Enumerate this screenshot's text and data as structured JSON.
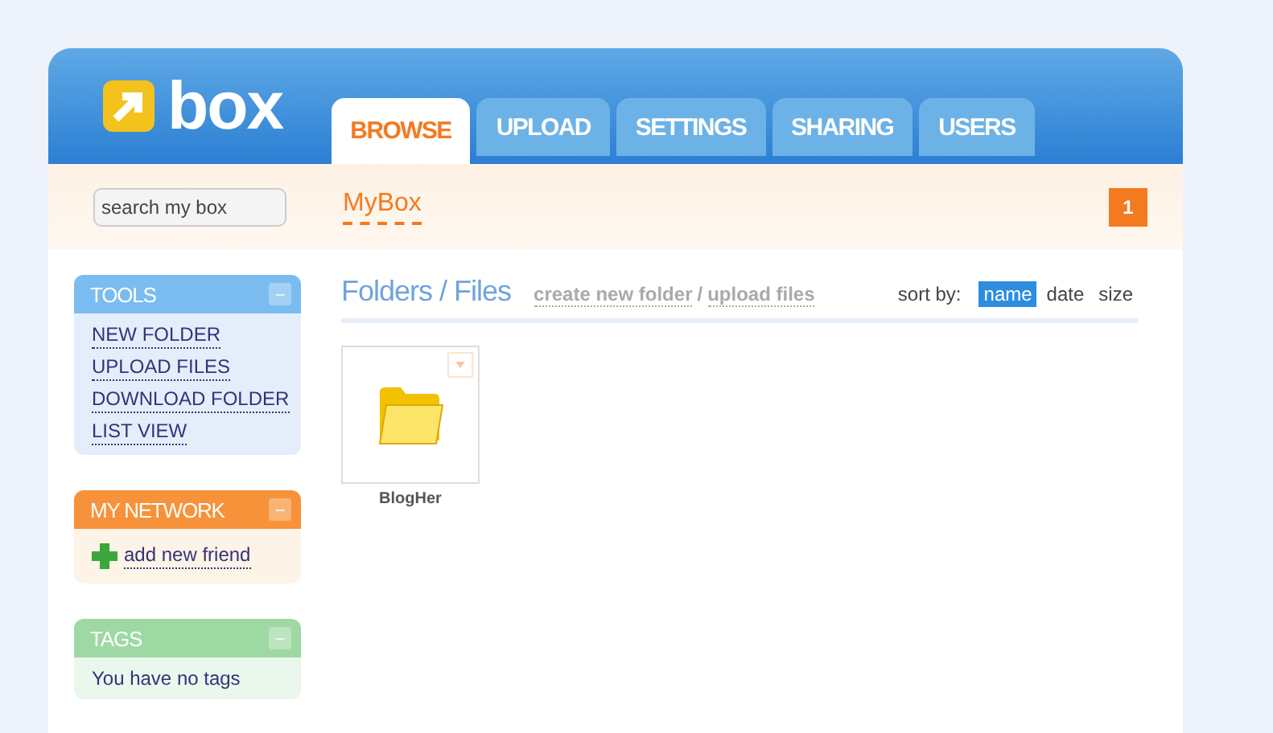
{
  "header": {
    "logo_text": "box"
  },
  "tabs": [
    {
      "label": "BROWSE",
      "selected": true
    },
    {
      "label": "UPLOAD",
      "selected": false
    },
    {
      "label": "SETTINGS",
      "selected": false
    },
    {
      "label": "SHARING",
      "selected": false
    },
    {
      "label": "USERS",
      "selected": false
    }
  ],
  "toolbar": {
    "search": {
      "placeholder": "search my box"
    },
    "breadcrumb": "MyBox",
    "badge": "1"
  },
  "sidebar": {
    "panels": [
      {
        "title": "TOOLS",
        "color": "#7bbcf0",
        "kind": "links",
        "collapse_icon": "–",
        "items": [
          "NEW FOLDER",
          "UPLOAD FILES",
          "DOWNLOAD FOLDER",
          "LIST VIEW"
        ]
      },
      {
        "title": "MY NETWORK",
        "color": "#f7923a",
        "kind": "add",
        "collapse_icon": "–",
        "items": [
          "add new friend"
        ]
      },
      {
        "title": "TAGS",
        "color": "#9ed9a4",
        "kind": "text",
        "collapse_icon": "–",
        "items": [
          "You have no tags"
        ]
      }
    ]
  },
  "main": {
    "title": "Folders / Files",
    "actions": [
      "create new folder",
      "upload files"
    ],
    "action_separator": "/",
    "sort_label": "sort by:",
    "sort_options": [
      {
        "label": "name",
        "selected": true
      },
      {
        "label": "date",
        "selected": false
      },
      {
        "label": "size",
        "selected": false
      }
    ],
    "items": [
      {
        "name": "BlogHer"
      }
    ]
  }
}
